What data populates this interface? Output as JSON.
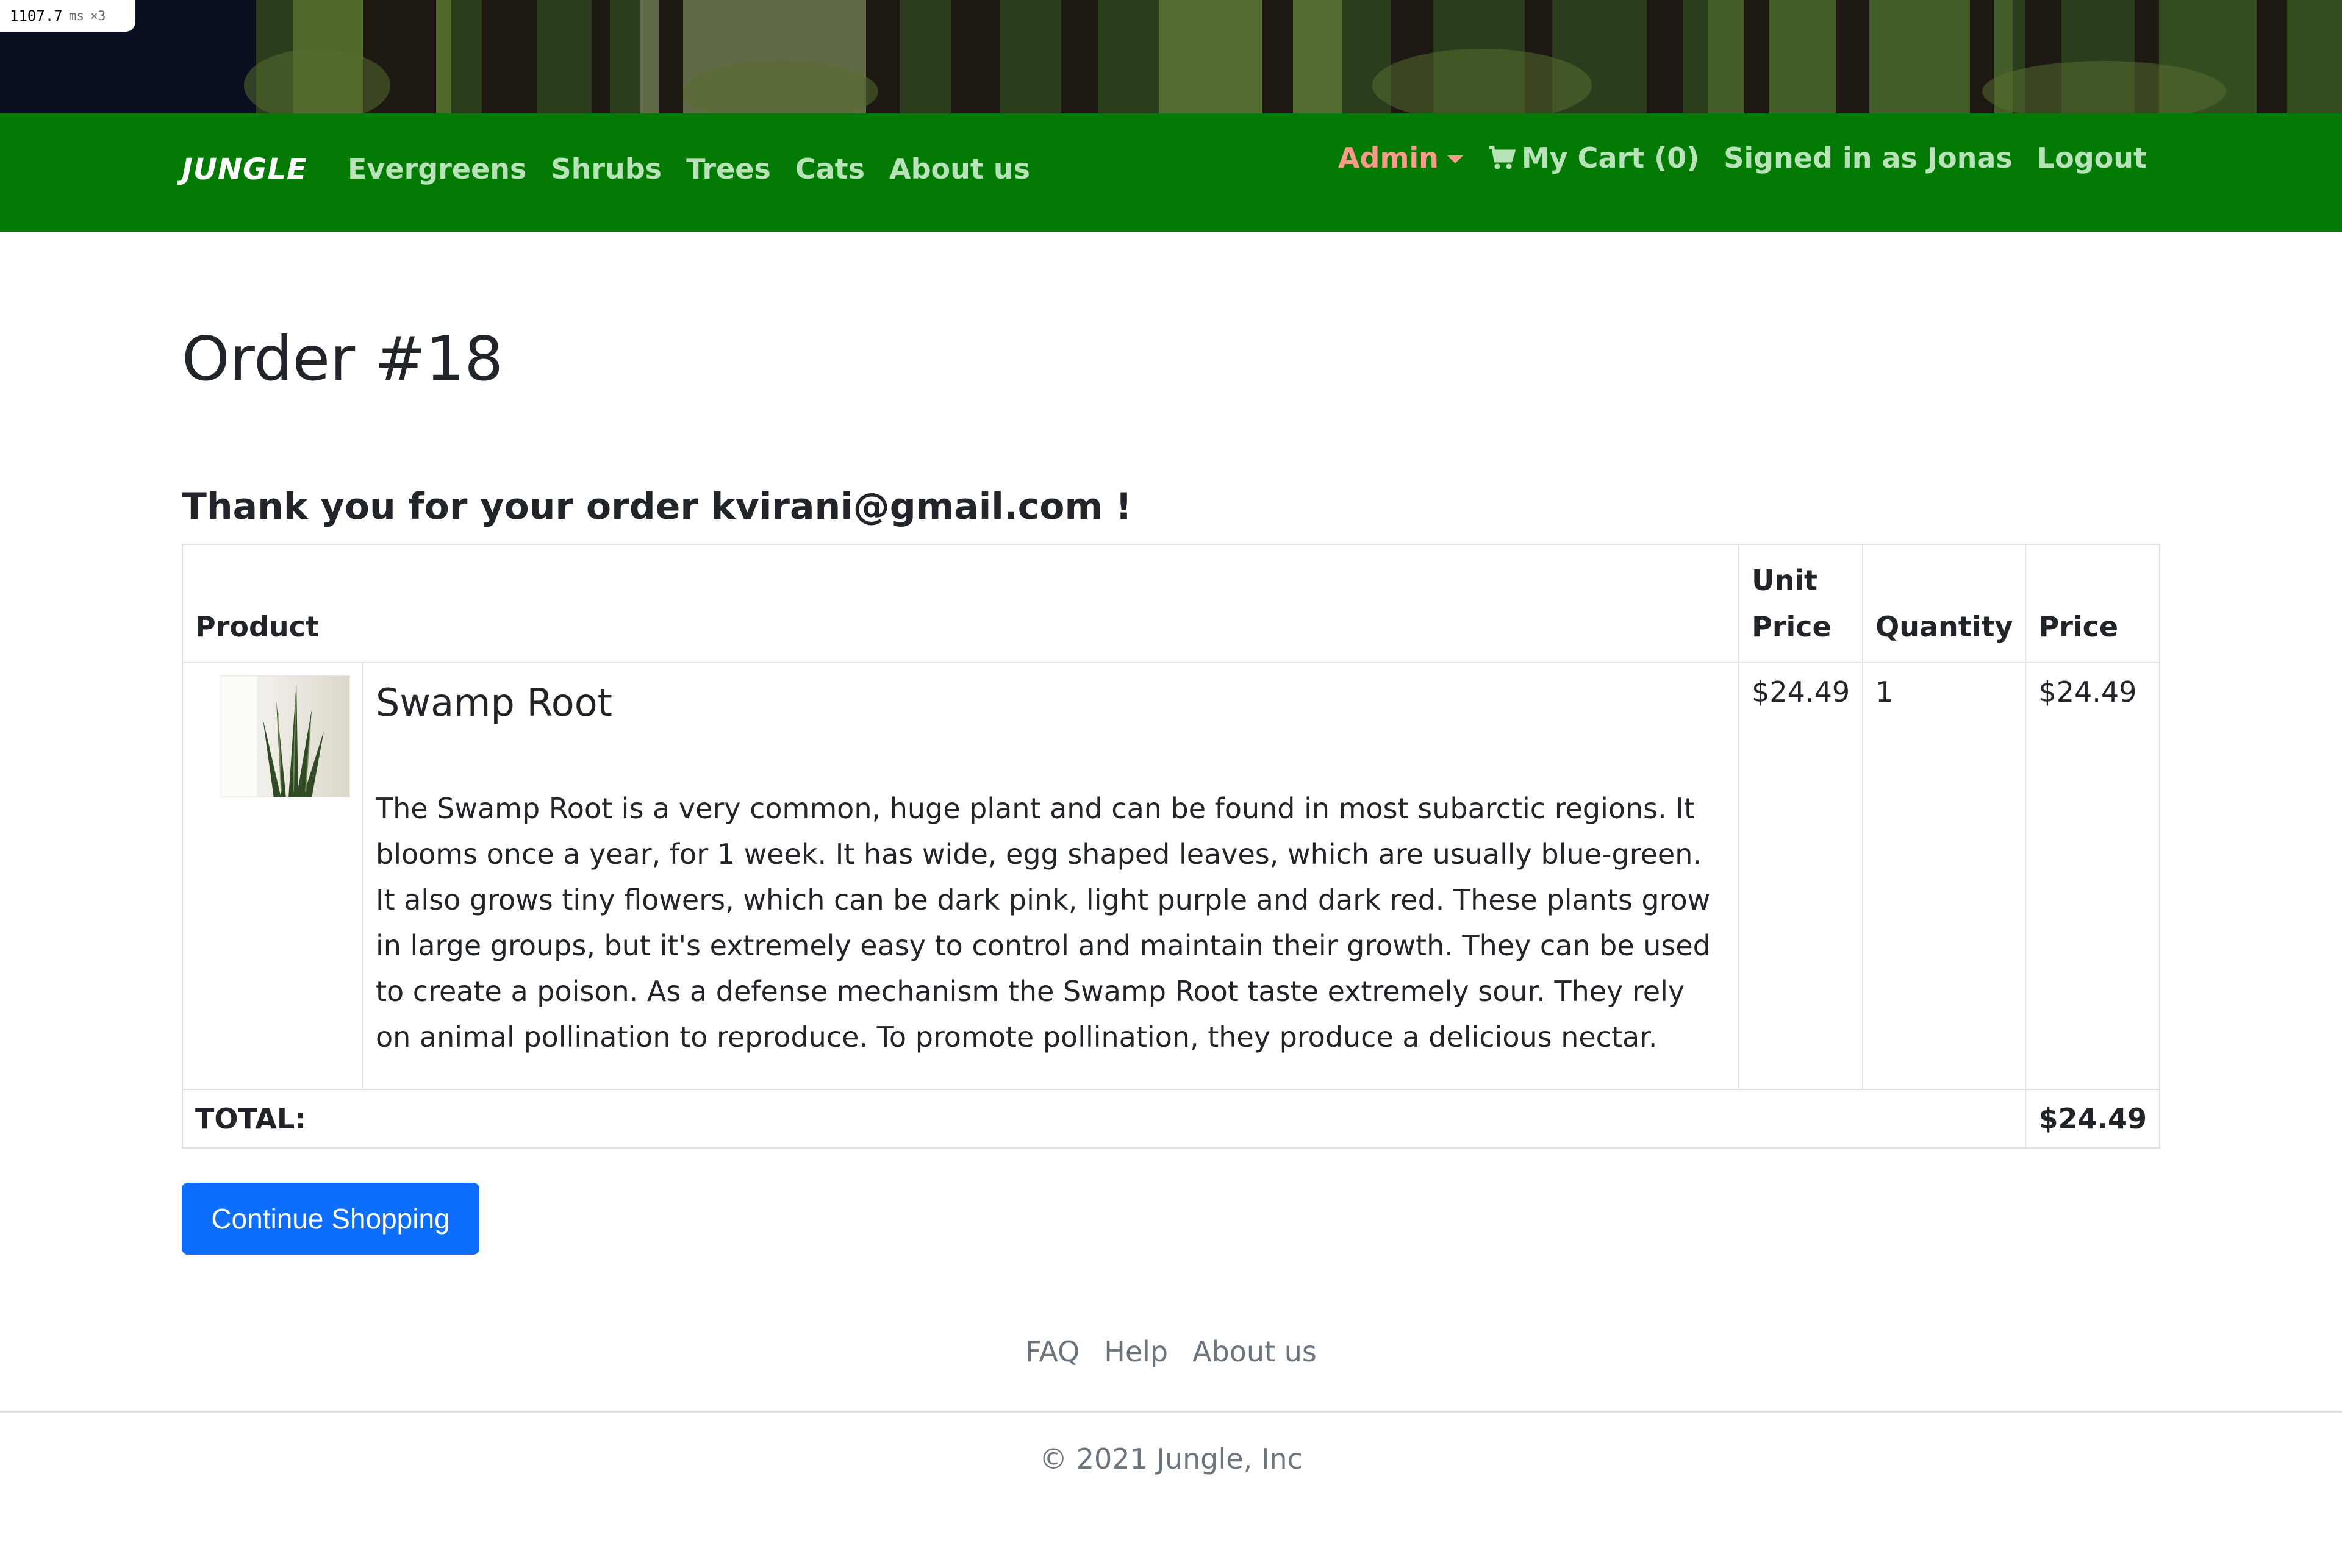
{
  "perf": {
    "value": "1107.7",
    "unit": "ms",
    "multiplier": "×3"
  },
  "nav": {
    "brand": "JUNGLE",
    "links": [
      "Evergreens",
      "Shrubs",
      "Trees",
      "Cats",
      "About us"
    ],
    "admin": "Admin",
    "cart": "My Cart (0)",
    "signed_in": "Signed in as Jonas",
    "logout": "Logout"
  },
  "page": {
    "title": "Order #18",
    "thanks": "Thank you for your order kvirani@gmail.com !"
  },
  "table": {
    "headers": {
      "product": "Product",
      "unit_price_1": "Unit",
      "unit_price_2": "Price",
      "quantity": "Quantity",
      "price": "Price"
    },
    "rows": [
      {
        "name": "Swamp Root",
        "description": "The Swamp Root is a very common, huge plant and can be found in most subarctic regions. It blooms once a year, for 1 week. It has wide, egg shaped leaves, which are usually blue-green. It also grows tiny flowers, which can be dark pink, light purple and dark red. These plants grow in large groups, but it's extremely easy to control and maintain their growth. They can be used to create a poison. As a defense mechanism the Swamp Root taste extremely sour. They rely on animal pollination to reproduce. To promote pollination, they produce a delicious nectar.",
        "unit_price": "$24.49",
        "quantity": "1",
        "price": "$24.49"
      }
    ],
    "total_label": "TOTAL:",
    "total_value": "$24.49"
  },
  "continue_button": "Continue Shopping",
  "footer": {
    "links": [
      "FAQ",
      "Help",
      "About us"
    ],
    "copyright": "© 2021 Jungle, Inc"
  },
  "colors": {
    "navbar": "#037a03",
    "admin": "#ff9a8a",
    "nav_link": "#b8e3b8",
    "button": "#0d6efd"
  }
}
